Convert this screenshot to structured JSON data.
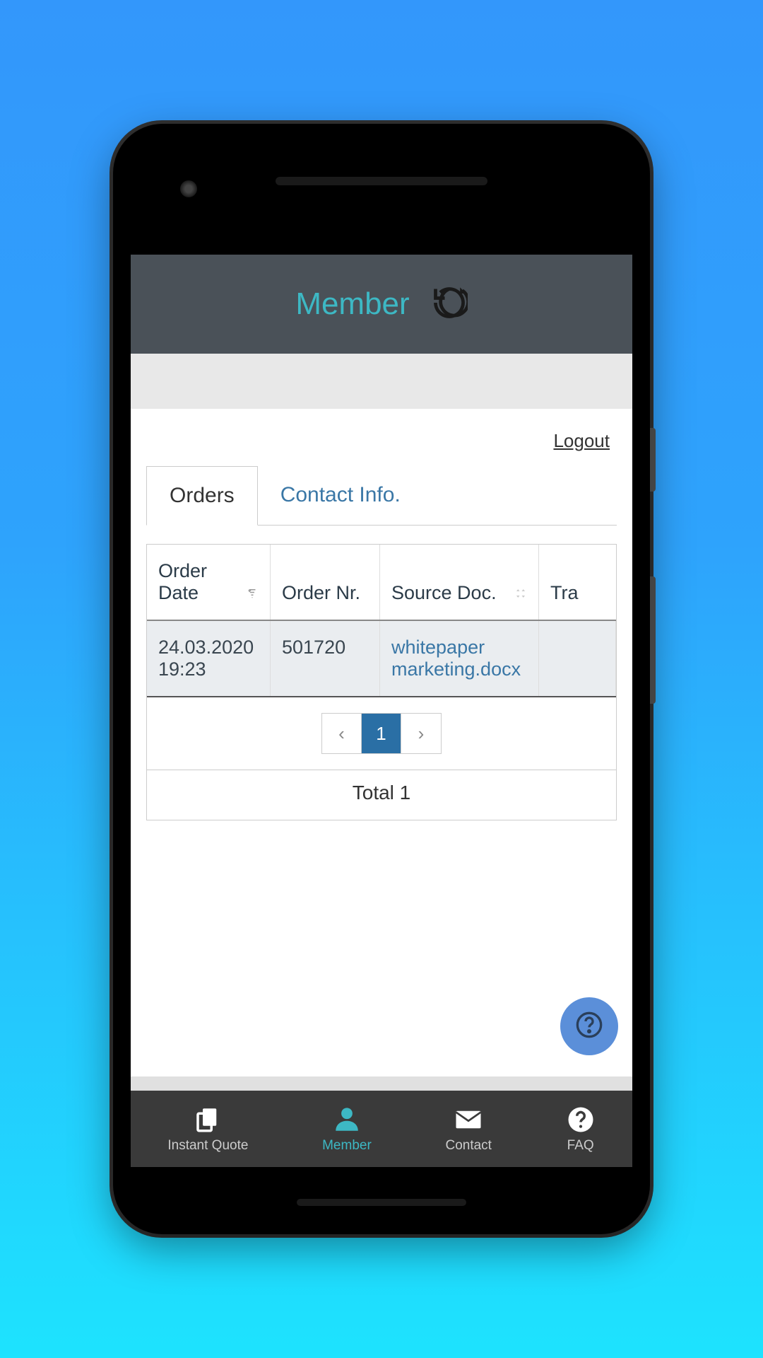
{
  "header": {
    "title": "Member"
  },
  "logout_label": "Logout",
  "tabs": {
    "orders": "Orders",
    "contact": "Contact Info."
  },
  "table": {
    "headers": {
      "order_date": "Order Date",
      "order_nr": "Order Nr.",
      "source_doc": "Source Doc.",
      "tra": "Tra"
    },
    "row": {
      "date": "24.03.2020 19:23",
      "nr": "501720",
      "doc": "whitepaper marketing.docx"
    }
  },
  "pagination": {
    "current": "1",
    "total_label": "Total 1"
  },
  "nav": {
    "quote": "Instant Quote",
    "member": "Member",
    "contact": "Contact",
    "faq": "FAQ"
  }
}
